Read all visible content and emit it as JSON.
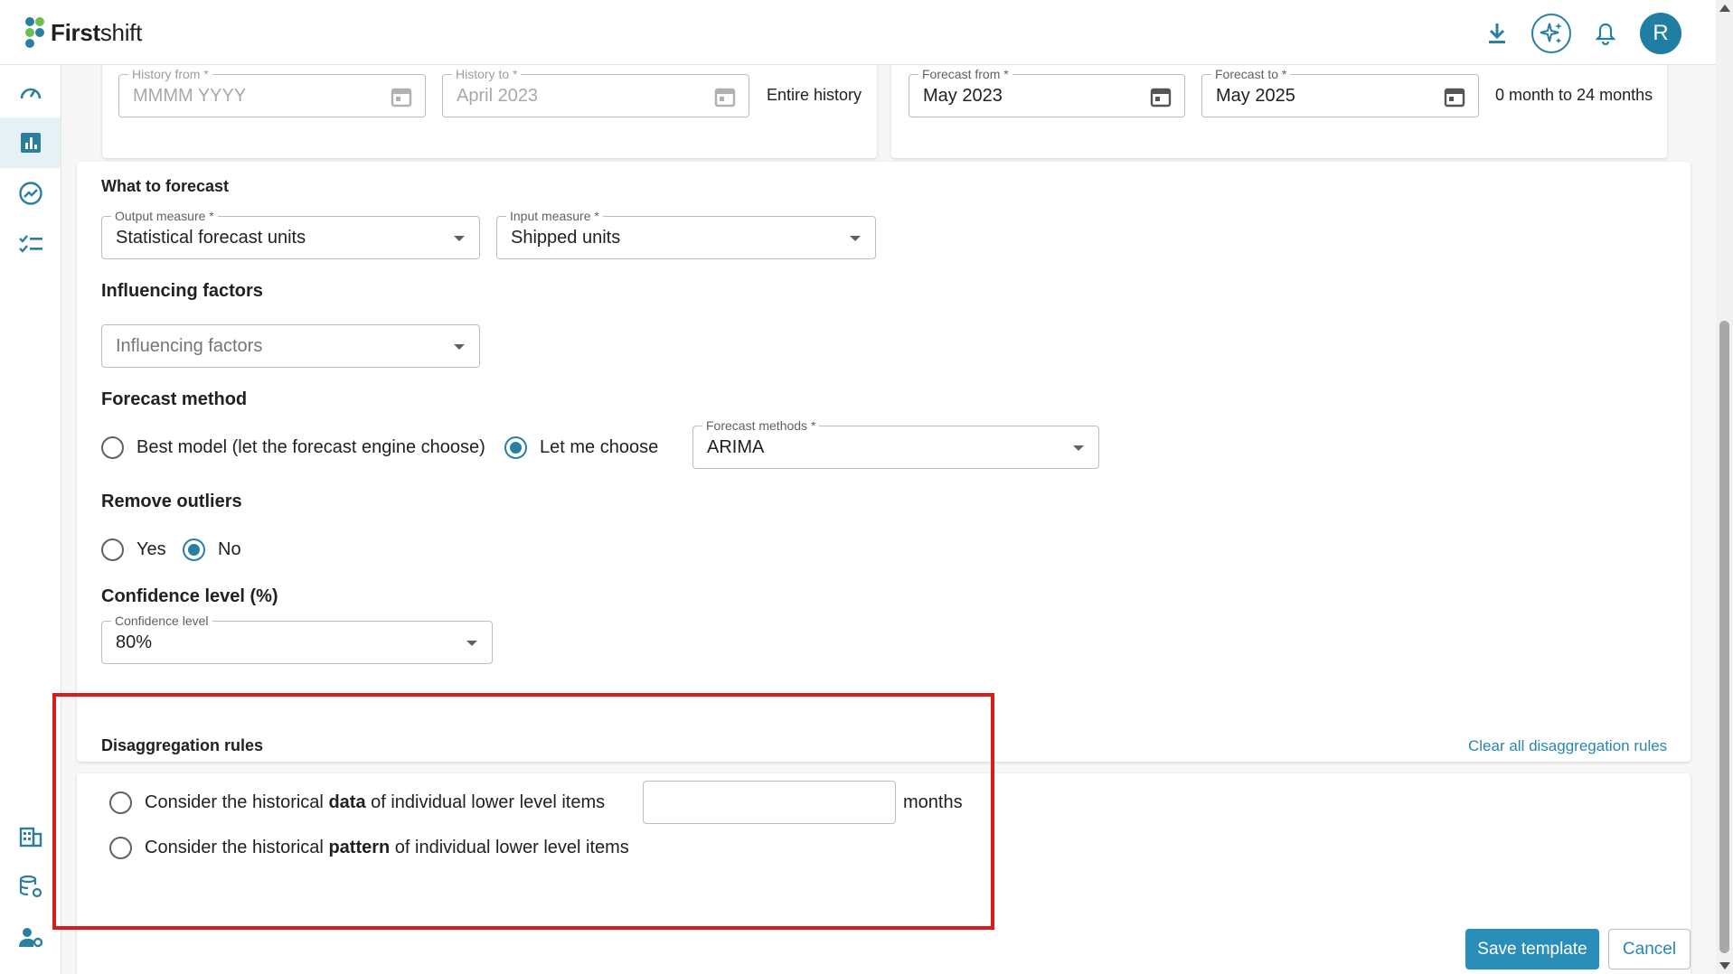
{
  "app": {
    "brand_bold": "First",
    "brand_light": "shift",
    "avatar_initial": "R"
  },
  "colors": {
    "accent": "#2a7fa0",
    "primary_button": "#2a8fb8",
    "highlight": "#d91c1c"
  },
  "history": {
    "from_label": "History from *",
    "from_placeholder": "MMMM YYYY",
    "to_label": "History to *",
    "to_value": "April 2023",
    "entire": "Entire history"
  },
  "forecast_range": {
    "from_label": "Forecast from *",
    "from_value": "May 2023",
    "to_label": "Forecast to *",
    "to_value": "May 2025",
    "note": "0 month to 24 months"
  },
  "what_to_forecast": {
    "title": "What to forecast",
    "output_label": "Output measure *",
    "output_value": "Statistical forecast units",
    "input_label": "Input measure *",
    "input_value": "Shipped units"
  },
  "influencing": {
    "title": "Influencing factors",
    "placeholder": "Influencing factors"
  },
  "forecast_method": {
    "title": "Forecast method",
    "best": "Best model (let the forecast engine choose)",
    "choose": "Let me choose",
    "methods_label": "Forecast methods *",
    "methods_value": "ARIMA"
  },
  "outliers": {
    "title": "Remove outliers",
    "yes": "Yes",
    "no": "No"
  },
  "confidence": {
    "title": "Confidence level (%)",
    "label": "Confidence level",
    "value": "80%"
  },
  "disaggregation": {
    "title": "Disaggregation rules",
    "clear": "Clear all disaggregation rules",
    "opt1_pre": "Consider the historical ",
    "opt1_bold": "data",
    "opt1_post": " of individual lower level items",
    "months": "months",
    "opt2_pre": "Consider the historical ",
    "opt2_bold": "pattern",
    "opt2_post": " of individual lower level items"
  },
  "actions": {
    "save": "Save template",
    "cancel": "Cancel"
  }
}
